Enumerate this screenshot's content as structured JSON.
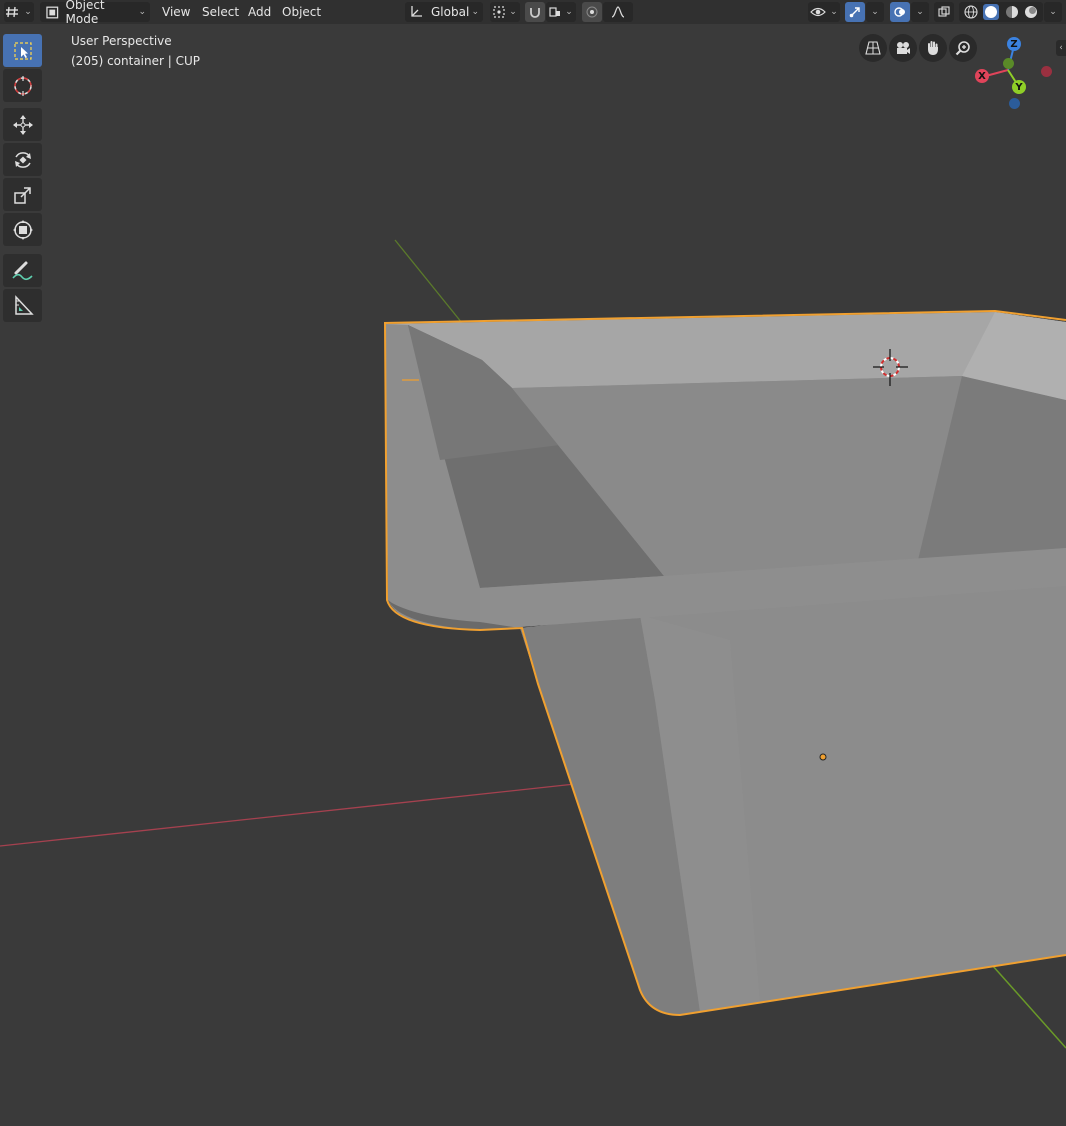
{
  "header": {
    "editor_type_icon": "editor-type-icon",
    "mode": {
      "label": "Object Mode",
      "icon": "object-mode-icon"
    },
    "menus": [
      "View",
      "Select",
      "Add",
      "Object"
    ],
    "transform_orientation": {
      "label": "Global",
      "icon": "transform-orientation-icon"
    },
    "pivot_icon": "pivot-point-icon",
    "snap_icon": "snap-magnet-icon",
    "snap_target_icon": "snap-target-icon",
    "proportional_icon": "proportional-editing-icon",
    "falloff_icon": "falloff-curve-icon",
    "visibility_icon": "eye-visibility-icon",
    "gizmo_icon": "gizmo-toggle-icon",
    "overlay_icon": "overlay-toggle-icon",
    "xray_icon": "xray-icon",
    "shading_modes": [
      "wireframe",
      "solid",
      "material",
      "rendered"
    ],
    "active_shading": "solid"
  },
  "viewport": {
    "perspective_label": "User Perspective",
    "object_info": "(205) container | CUP"
  },
  "toolbar": {
    "tools": [
      {
        "name": "select-box",
        "icon": "select-box-icon",
        "active": true
      },
      {
        "name": "cursor",
        "icon": "cursor-icon",
        "active": false
      },
      {
        "name": "move",
        "icon": "move-icon",
        "active": false
      },
      {
        "name": "rotate",
        "icon": "rotate-icon",
        "active": false
      },
      {
        "name": "scale",
        "icon": "scale-icon",
        "active": false
      },
      {
        "name": "transform",
        "icon": "transform-icon",
        "active": false
      },
      {
        "name": "annotate",
        "icon": "annotate-icon",
        "active": false
      },
      {
        "name": "measure",
        "icon": "measure-icon",
        "active": false
      }
    ]
  },
  "navigation": {
    "buttons": [
      "toggle-camera-view-icon",
      "camera-icon",
      "hand-pan-icon",
      "zoom-icon"
    ],
    "gizmo_axes": {
      "x": "X",
      "y": "Y",
      "z": "Z"
    }
  },
  "colors": {
    "accent": "#4772b3",
    "selection_outline": "#f0a030",
    "x_axis": "#e0445a",
    "y_axis": "#8fce27",
    "z_axis": "#3b82e0",
    "mesh": "#8f8f8f",
    "background": "#3a3a3a",
    "header": "#303030"
  }
}
